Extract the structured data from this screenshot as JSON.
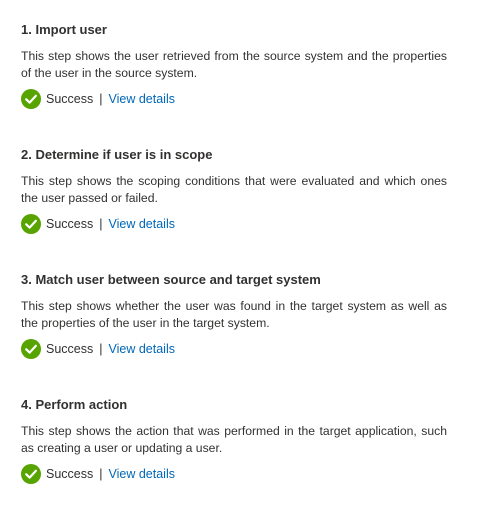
{
  "steps": [
    {
      "title": "1. Import user",
      "description": "This step shows the user retrieved from the source system and the properties of the user in the source system.",
      "status": "Success",
      "separator": "|",
      "link": "View details",
      "status_icon": "success-check-icon"
    },
    {
      "title": "2. Determine if user is in scope",
      "description": "This step shows the scoping conditions that were evaluated and which ones the user passed or failed.",
      "status": "Success",
      "separator": "|",
      "link": "View details",
      "status_icon": "success-check-icon"
    },
    {
      "title": "3. Match user between source and target system",
      "description": "This step shows whether the user was found in the target system as well as the properties of the user in the target system.",
      "status": "Success",
      "separator": "|",
      "link": "View details",
      "status_icon": "success-check-icon"
    },
    {
      "title": "4. Perform action",
      "description": "This step shows the action that was performed in the target application, such as creating a user or updating a user.",
      "status": "Success",
      "separator": "|",
      "link": "View details",
      "status_icon": "success-check-icon"
    }
  ],
  "colors": {
    "success": "#57a300",
    "link": "#0067b8",
    "text": "#323130"
  }
}
